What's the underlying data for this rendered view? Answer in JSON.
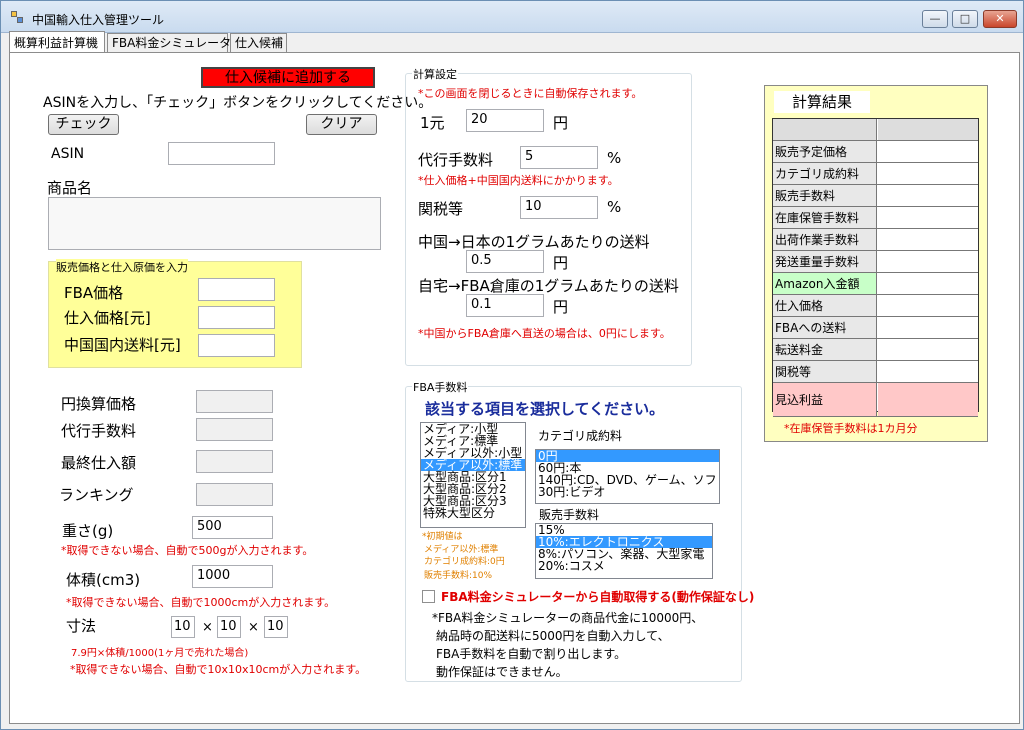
{
  "window": {
    "title": "中国輸入仕入管理ツール",
    "min": "—",
    "max": "□",
    "close": "✕"
  },
  "tabs": [
    "概算利益計算機",
    "FBA料金シミュレーター",
    "仕入候補"
  ],
  "left": {
    "add_candidate": "仕入候補に追加する",
    "instruction": "ASINを入力し、「チェック」ボタンをクリックしてください。",
    "check": "チェック",
    "clear": "クリア",
    "asin_label": "ASIN",
    "asin_value": "",
    "product_label": "商品名",
    "product_value": "",
    "price_group_title": "販売価格と仕入原価を入力",
    "fba_price": "FBA価格",
    "purchase_price": "仕入価格[元]",
    "domestic_ship": "中国国内送料[元]",
    "yen_price": "円換算価格",
    "agency_fee": "代行手数料",
    "final_cost": "最終仕入額",
    "ranking": "ランキング",
    "weight_label": "重さ(g)",
    "weight_value": "500",
    "weight_note": "*取得できない場合、自動で500gが入力されます。",
    "volume_label": "体積(cm3)",
    "volume_value": "1000",
    "volume_note": "*取得できない場合、自動で1000cmが入力されます。",
    "dims_label": "寸法",
    "dim1": "10",
    "dim2": "10",
    "dim3": "10",
    "times": "×",
    "dims_note1": "7.9円×体積/1000(1ヶ月で売れた場合)",
    "dims_note2": "*取得できない場合、自動で10x10x10cmが入力されます。"
  },
  "settings": {
    "title": "計算設定",
    "autosave_note": "*この画面を閉じるときに自動保存されます。",
    "yuan_label": "1元",
    "yuan_value": "20",
    "yen": "円",
    "agency_label": "代行手数料",
    "agency_value": "5",
    "percent": "%",
    "agency_note": "*仕入価格+中国国内送料にかかります。",
    "tariff_label": "関税等",
    "tariff_value": "10",
    "cn_jp_label": "中国→日本の1グラムあたりの送料",
    "cn_jp_value": "0.5",
    "home_fba_label": "自宅→FBA倉庫の1グラムあたりの送料",
    "home_fba_value": "0.1",
    "direct_note": "*中国からFBA倉庫へ直送の場合は、0円にします。"
  },
  "fba": {
    "title": "FBA手数料",
    "heading": "該当する項目を選択してください。",
    "size_options": [
      "メディア:小型",
      "メディア:標準",
      "メディア以外:小型",
      "メディア以外:標準",
      "大型商品:区分1",
      "大型商品:区分2",
      "大型商品:区分3",
      "特殊大型区分"
    ],
    "size_selected": 3,
    "category_label": "カテゴリ成約料",
    "category_options": [
      "0円",
      "60円:本",
      "140円:CD、DVD、ゲーム、ソフト",
      "30円:ビデオ"
    ],
    "category_selected": 0,
    "sales_label": "販売手数料",
    "sales_options": [
      "15%",
      "10%:エレクトロニクス",
      "8%:パソコン、楽器、大型家電",
      "20%:コスメ"
    ],
    "sales_selected": 1,
    "init_note1": "*初期値は",
    "init_note2": "メディア以外:標準",
    "init_note3": "カテゴリ成約料:0円",
    "init_note4": "販売手数料:10%",
    "auto_label": "FBA料金シミュレーターから自動取得する(動作保証なし)",
    "auto_note1": "*FBA料金シミュレーターの商品代金に10000円、",
    "auto_note2": "納品時の配送料に5000円を自動入力して、",
    "auto_note3": "FBA手数料を自動で割り出します。",
    "auto_note4": "動作保証はできません。"
  },
  "results": {
    "title": "計算結果",
    "rows": [
      "販売予定価格",
      "カテゴリ成約料",
      "販売手数料",
      "在庫保管手数料",
      "出荷作業手数料",
      "発送重量手数料",
      "Amazon入金額",
      "仕入価格",
      "FBAへの送料",
      "転送料金",
      "関税等",
      "見込利益"
    ],
    "note": "*在庫保管手数料は1カ月分",
    "panel_color": "#ffffc0",
    "amazon_color": "#c8ffc8",
    "profit_color": "#ffc8c8"
  }
}
